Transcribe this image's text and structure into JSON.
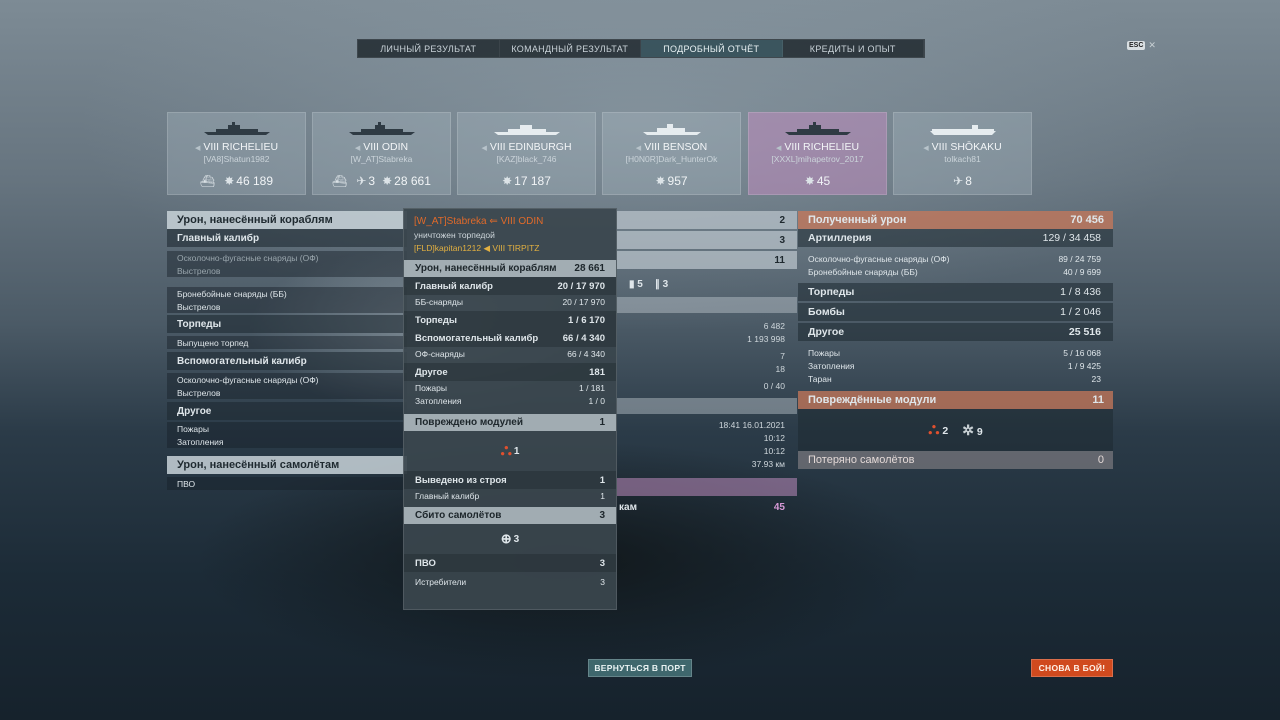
{
  "tabs": [
    "ЛИЧНЫЙ РЕЗУЛЬТАТ",
    "КОМАНДНЫЙ РЕЗУЛЬТАТ",
    "ПОДРОБНЫЙ ОТЧЁТ",
    "КРЕДИТЫ И ОПЫТ"
  ],
  "active_tab": "ПОДРОБНЫЙ ОТЧЁТ",
  "esc_key": "ESC",
  "ships": [
    {
      "name": "VIII RICHELIEU",
      "player": "[VA8]Shatun1982",
      "stats": [
        {
          "icon": "ship-icon",
          "value": ""
        },
        {
          "icon": "damage-icon",
          "value": "46 189"
        }
      ]
    },
    {
      "name": "VIII ODIN",
      "player": "[W_AT]Stabreka",
      "stats": [
        {
          "icon": "ship-icon",
          "value": ""
        },
        {
          "icon": "plane-icon",
          "value": "3"
        },
        {
          "icon": "damage-icon",
          "value": "28 661"
        }
      ]
    },
    {
      "name": "VIII EDINBURGH",
      "player": "[KAZ]black_746",
      "stats": [
        {
          "icon": "damage-icon",
          "value": "17 187"
        }
      ]
    },
    {
      "name": "VIII BENSON",
      "player": "[H0N0R]Dark_HunterOk",
      "stats": [
        {
          "icon": "damage-icon",
          "value": "957"
        }
      ]
    },
    {
      "name": "VIII RICHELIEU",
      "player": "[XXXL]mihapetrov_2017",
      "stats": [
        {
          "icon": "damage-icon",
          "value": "45"
        }
      ]
    },
    {
      "name": "VIII SHŌKAKU",
      "player": "tolkach81",
      "stats": [
        {
          "icon": "plane-icon",
          "value": "8"
        }
      ]
    }
  ],
  "left_panel": {
    "header": "Урон, нанесённый кораблям",
    "main_caliber": "Главный калибр",
    "he_shells": "Осколочно-фугасные снаряды (ОФ)",
    "shots": "Выстрелов",
    "ap_shells": "Бронебойные снаряды (ББ)",
    "shots2": "Выстрелов",
    "torpedoes": "Торпеды",
    "torpedoes_launched": "Выпущено торпед",
    "secondary": "Вспомогательный калибр",
    "he_shells2": "Осколочно-фугасные снаряды (ОФ)",
    "shots3": "Выстрелов",
    "other": "Другое",
    "fires": "Пожары",
    "floods": "Затопления",
    "aircraft_header": "Урон, нанесённый самолётам",
    "aa": "ПВО"
  },
  "middle": {
    "row1": "2",
    "row2": "3",
    "row3": "11",
    "icons1": "5",
    "icons2": "3",
    "v1": "6 482",
    "v2": "1 193 998",
    "v3": "7",
    "v4": "18",
    "v5": "0 / 40",
    "time": "18:41  16.01.2021",
    "t1": "10:12",
    "t2": "10:12",
    "dist": "37.93 км",
    "partial_label": "кам",
    "partial_value": "45"
  },
  "popup": {
    "killer": "[W_AT]Stabreka",
    "killer_ship": "VIII ODIN",
    "killed_by": "уничтожен торпедой",
    "victim": "[FLD]kapitan1212",
    "victim_ship": "VIII TIRPITZ",
    "damage_header": "Урон, нанесённый кораблям",
    "damage_total": "28 661",
    "rows": [
      {
        "label": "Главный калибр",
        "value": "20 / 17 970",
        "bold": true
      },
      {
        "label": "ББ-снаряды",
        "value": "20 / 17 970",
        "bold": false
      },
      {
        "label": "Торпеды",
        "value": "1 / 6 170",
        "bold": true
      },
      {
        "label": "Вспомогательный калибр",
        "value": "66 / 4 340",
        "bold": true
      },
      {
        "label": "ОФ-снаряды",
        "value": "66 / 4 340",
        "bold": false
      },
      {
        "label": "Другое",
        "value": "181",
        "bold": true
      },
      {
        "label": "Пожары",
        "value": "1 / 181",
        "bold": false
      },
      {
        "label": "Затопления",
        "value": "1 / 0",
        "bold": false
      }
    ],
    "modules_header": "Повреждено модулей",
    "modules_total": "1",
    "modules_icon_value": "1",
    "disabled_label": "Выведено из строя",
    "disabled_value": "1",
    "main_caliber_label": "Главный калибр",
    "main_caliber_value": "1",
    "planes_header": "Сбито самолётов",
    "planes_total": "3",
    "planes_icon_value": "3",
    "aa_label": "ПВО",
    "aa_value": "3",
    "fighters_label": "Истребители",
    "fighters_value": "3"
  },
  "right_panel": {
    "received_header": "Полученный урон",
    "received_total": "70 456",
    "artillery": "Артиллерия",
    "artillery_value": "129 / 34 458",
    "he": "Осколочно-фугасные снаряды (ОФ)",
    "he_value": "89 / 24 759",
    "ap": "Бронебойные снаряды (ББ)",
    "ap_value": "40 / 9 699",
    "torpedoes": "Торпеды",
    "torpedoes_value": "1 / 8 436",
    "bombs": "Бомбы",
    "bombs_value": "1 / 2 046",
    "other": "Другое",
    "other_value": "25 516",
    "fires": "Пожары",
    "fires_value": "5 / 16 068",
    "floods": "Затопления",
    "floods_value": "1 / 9 425",
    "ram": "Таран",
    "ram_value": "23",
    "modules_header": "Повреждённые модули",
    "modules_value": "11",
    "mod_icon1_value": "2",
    "mod_icon2_value": "9",
    "planes_lost": "Потеряно самолётов",
    "planes_lost_value": "0"
  },
  "buttons": {
    "port": "ВЕРНУТЬСЯ В ПОРТ",
    "battle": "СНОВА В БОЙ!"
  },
  "colors": {
    "accent_orange": "#d04a1e",
    "highlight_purple": "#be8cbe",
    "killer_orange": "#e06a2a",
    "victim_gold": "#e2b041"
  }
}
